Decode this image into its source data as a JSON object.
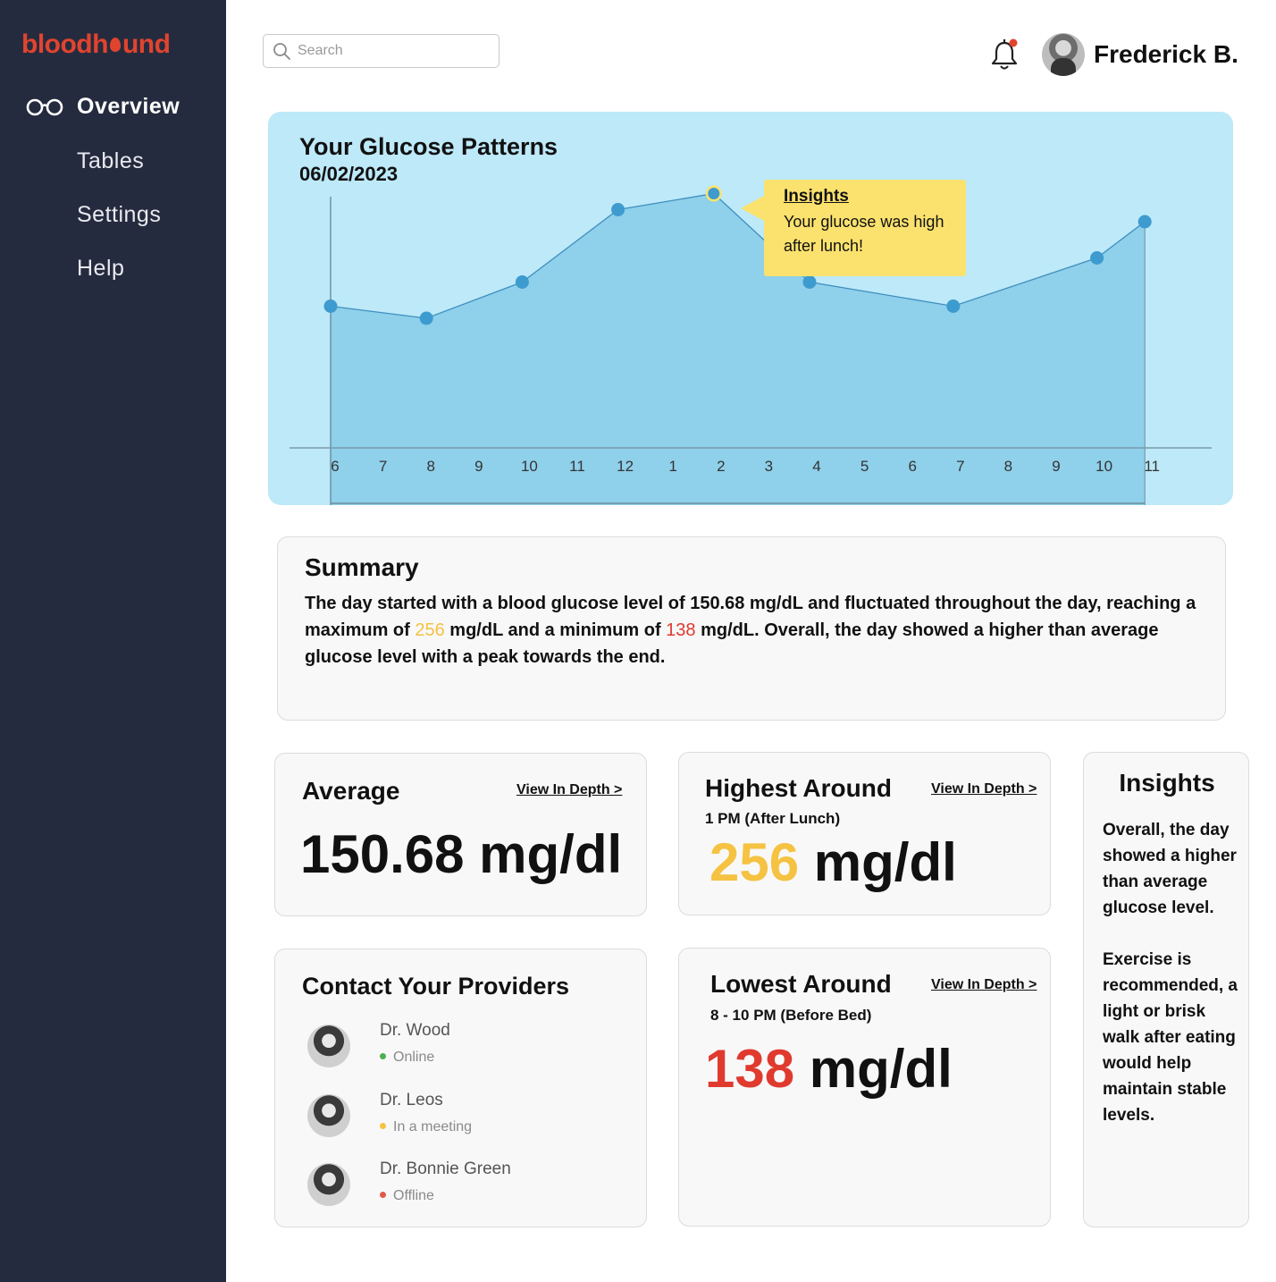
{
  "app": {
    "logo_text_left": "blood",
    "logo_text_right": "und",
    "logo_h": "h",
    "brand_color": "#e0442f"
  },
  "sidebar": {
    "items": [
      {
        "label": "Overview",
        "active": true,
        "icon": "glasses-icon"
      },
      {
        "label": "Tables",
        "active": false
      },
      {
        "label": "Settings",
        "active": false
      },
      {
        "label": "Help",
        "active": false
      }
    ]
  },
  "header": {
    "search_placeholder": "Search",
    "user_name": "Frederick B.",
    "notification_icon": "bell-icon",
    "notification_dot_color": "#e0442f"
  },
  "glucose_chart": {
    "title": "Your Glucose Patterns",
    "date": "06/02/2023",
    "tooltip_title": "Insights",
    "tooltip_text": "Your glucose was high after lunch!"
  },
  "chart_data": {
    "type": "area",
    "x_ticks": [
      "6",
      "7",
      "8",
      "9",
      "10",
      "11",
      "12",
      "1",
      "2",
      "3",
      "4",
      "5",
      "6",
      "7",
      "8",
      "9",
      "10",
      "11"
    ],
    "points": [
      {
        "x": "6",
        "y": 180
      },
      {
        "x": "8",
        "y": 174
      },
      {
        "x": "10",
        "y": 192
      },
      {
        "x": "12",
        "y": 228
      },
      {
        "x": "2",
        "y": 236
      },
      {
        "x": "4",
        "y": 192
      },
      {
        "x": "7",
        "y": 180
      },
      {
        "x": "10",
        "y": 204
      },
      {
        "x": "11",
        "y": 222
      }
    ],
    "highlight_index": 4,
    "colors": {
      "area": "#8fd0ea",
      "line": "#3f8fbf",
      "point": "#3d9bcf",
      "highlight": "#fbe26e",
      "background": "#bde9f9"
    }
  },
  "summary": {
    "title": "Summary",
    "text_1": "The day started with a blood glucose level of 150.68 mg/dL and fluctuated throughout the day, reaching a maximum of ",
    "max": "256",
    "text_2": " mg/dL and a minimum of ",
    "min": "138",
    "text_3": " mg/dL. Overall, the day showed a ",
    "emphasis": "higher than average glucose level",
    "text_4": " with a peak towards the end."
  },
  "average": {
    "title": "Average",
    "link": "View In Depth >",
    "value": "150.68 mg/dl"
  },
  "highest": {
    "title": "Highest Around",
    "subtitle": "1 PM (After Lunch)",
    "link": "View In Depth >",
    "number": "256",
    "unit": " mg/dl",
    "color": "#f5c242"
  },
  "lowest": {
    "title": "Lowest Around",
    "subtitle": "8 - 10 PM (Before Bed)",
    "link": "View In Depth >",
    "number": "138",
    "unit": " mg/dl",
    "color": "#e03a2f"
  },
  "providers": {
    "title": "Contact Your Providers",
    "list": [
      {
        "name": "Dr. Wood",
        "status": "Online",
        "status_color": "#4caf50"
      },
      {
        "name": "Dr. Leos",
        "status": "In a meeting",
        "status_color": "#f5c242"
      },
      {
        "name": "Dr. Bonnie Green",
        "status": "Offline",
        "status_color": "#e05a4a"
      }
    ]
  },
  "insights": {
    "title": "Insights",
    "p1_a": "Overall, the day showed a ",
    "p1_b": "higher than average glucose level.",
    "p2": "Exercise is recommended, a light or brisk walk after eating would help maintain stable levels."
  }
}
